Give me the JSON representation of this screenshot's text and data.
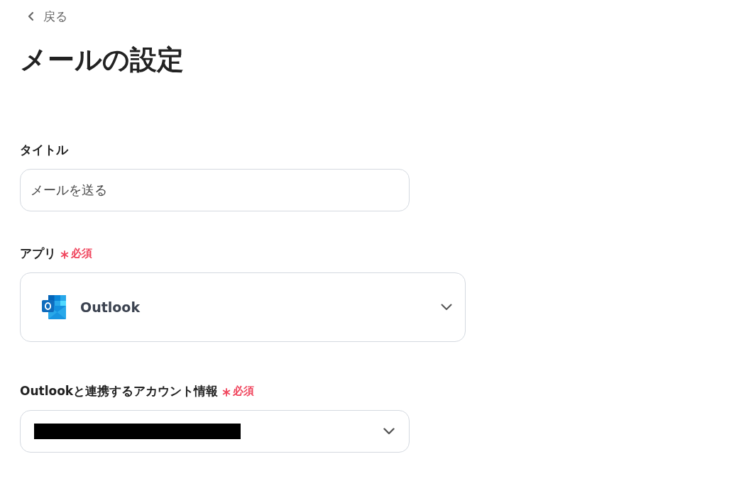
{
  "back_link": {
    "label": "戻る"
  },
  "page_title": "メールの設定",
  "fields": [
    {
      "kind": "text",
      "label": "タイトル",
      "value": "メールを送る"
    },
    {
      "kind": "app_select",
      "label": "アプリ",
      "required_label": "必須",
      "value": "Outlook"
    },
    {
      "kind": "account_select",
      "label": "Outlookと連携するアカウント情報",
      "required_label": "必須",
      "redacted": true
    }
  ]
}
